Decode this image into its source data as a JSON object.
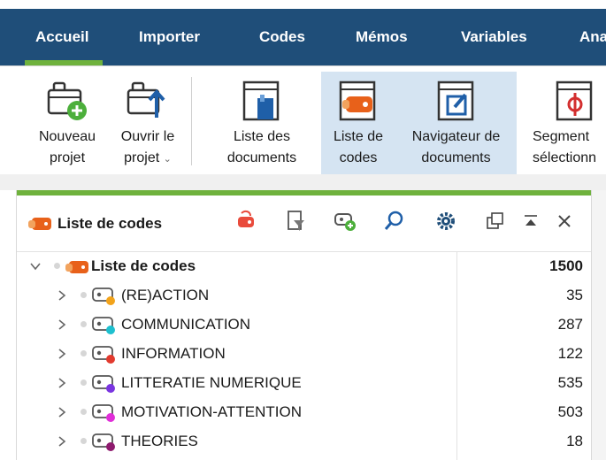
{
  "tabs": [
    {
      "label": "Accueil",
      "active": true
    },
    {
      "label": "Importer"
    },
    {
      "label": "Codes"
    },
    {
      "label": "Mémos"
    },
    {
      "label": "Variables"
    },
    {
      "label": "Ana"
    }
  ],
  "ribbon": {
    "new_project": [
      "Nouveau",
      "projet"
    ],
    "open_project": [
      "Ouvrir le",
      "projet"
    ],
    "open_project_chevron": "⌄",
    "doc_list": [
      "Liste des",
      "documents"
    ],
    "code_list": [
      "Liste de",
      "codes"
    ],
    "doc_navigator": [
      "Navigateur de",
      "documents"
    ],
    "segments": [
      "Segment",
      "sélectionn"
    ]
  },
  "panel": {
    "title": "Liste de codes",
    "accent": "#6fb23d",
    "root": {
      "name": "Liste de codes",
      "count": "1500"
    },
    "codes": [
      {
        "name": "(RE)ACTION",
        "count": "35",
        "color": "#f2a31b"
      },
      {
        "name": "COMMUNICATION",
        "count": "287",
        "color": "#1ec0cf"
      },
      {
        "name": "INFORMATION",
        "count": "122",
        "color": "#e23a2e"
      },
      {
        "name": "LITTERATIE NUMERIQUE",
        "count": "535",
        "color": "#7a35e0"
      },
      {
        "name": "MOTIVATION-ATTENTION",
        "count": "503",
        "color": "#e02fd8"
      },
      {
        "name": "THEORIES",
        "count": "18",
        "color": "#8e1a6e"
      }
    ]
  },
  "colors": {
    "tabbar": "#1f4e79",
    "accent_green": "#6fb23d",
    "selected": "#d5e4f2",
    "code_orange": "#e8611a"
  }
}
